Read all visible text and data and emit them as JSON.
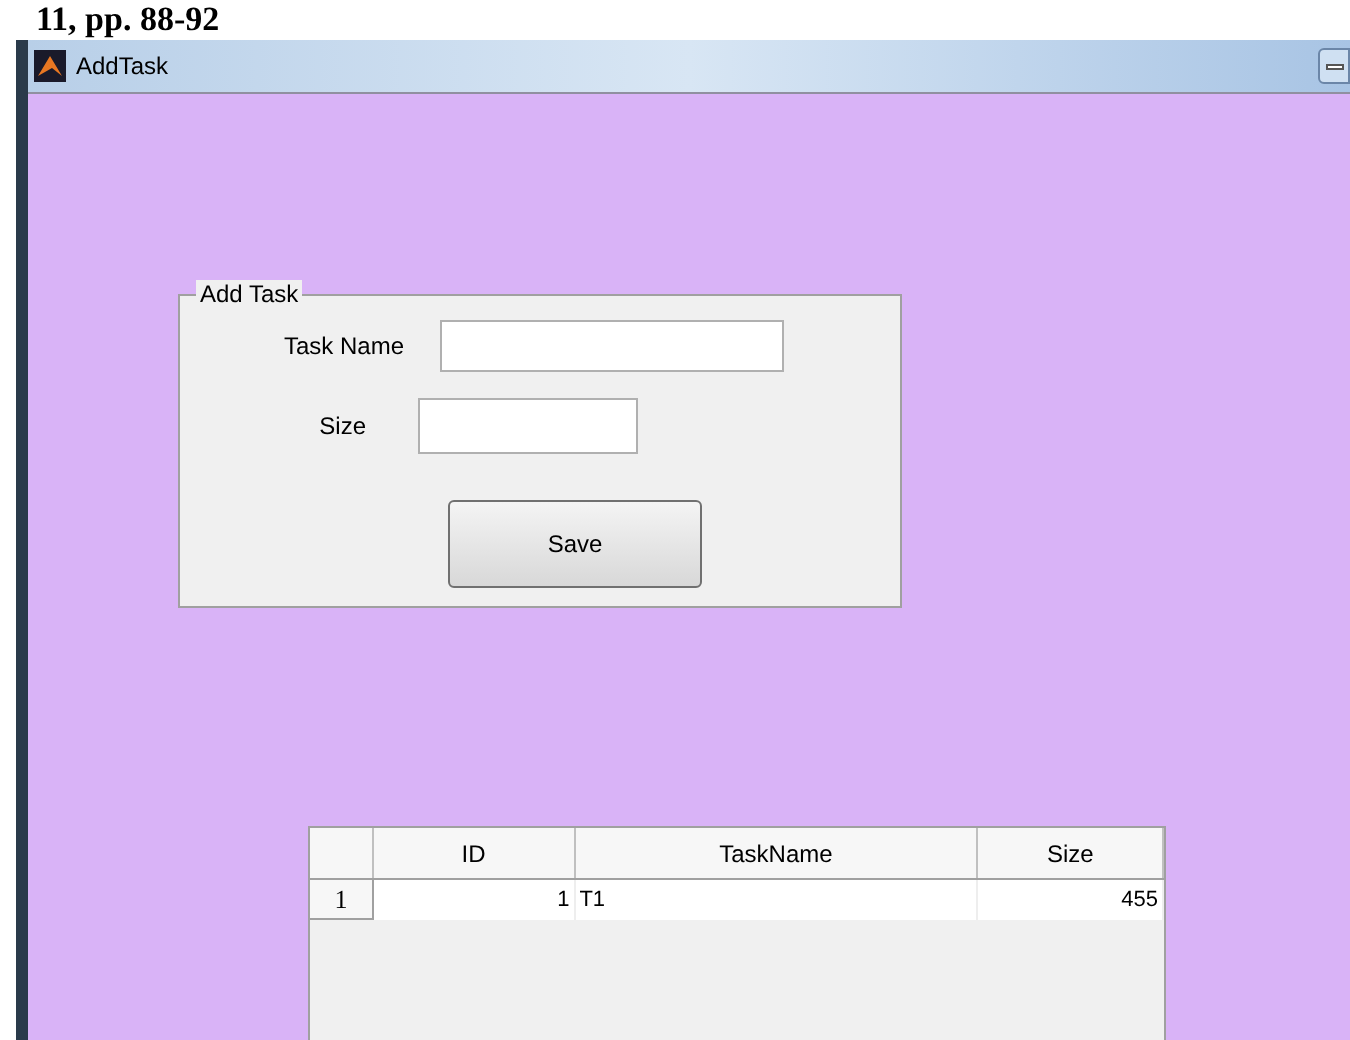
{
  "caption": "11, pp. 88-92",
  "window": {
    "title": "AddTask"
  },
  "panel": {
    "title": "Add Task",
    "fields": [
      {
        "label": "Task Name"
      },
      {
        "label": "Size"
      }
    ],
    "button": "Save"
  },
  "table": {
    "columns": [
      "ID",
      "TaskName",
      "Size"
    ],
    "rows": [
      {
        "header": "1",
        "cells": [
          "1",
          "T1",
          "455"
        ]
      }
    ]
  }
}
